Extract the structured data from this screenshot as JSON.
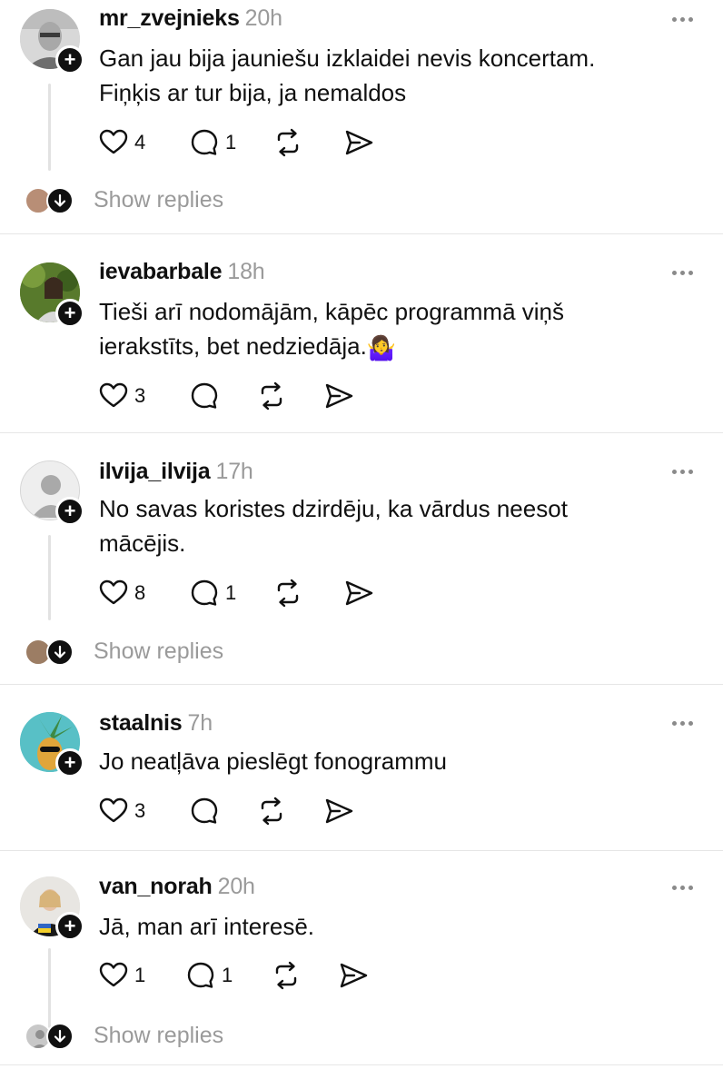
{
  "actions_labels": {
    "like": "like",
    "reply": "reply",
    "repost": "repost",
    "share": "share"
  },
  "posts": [
    {
      "username": "mr_zvejnieks",
      "time": "20h",
      "lines": [
        "Gan jau bija jauniešu izklaidei nevis koncertam.",
        "Fiņķis ar tur bija, ja nemaldos"
      ],
      "likes": "4",
      "replies": "1",
      "show_replies": "Show replies"
    },
    {
      "username": "ievabarbale",
      "time": "18h",
      "lines": [
        "Tieši arī nodomājām, kāpēc programmā viņš",
        "ierakstīts, bet nedziedāja."
      ],
      "emoji": "🤷‍♀️",
      "likes": "3",
      "replies": ""
    },
    {
      "username": "ilvija_ilvija",
      "time": "17h",
      "lines": [
        "No savas koristes dzirdēju, ka vārdus neesot",
        "mācējis."
      ],
      "likes": "8",
      "replies": "1",
      "show_replies": "Show replies"
    },
    {
      "username": "staalnis",
      "time": "7h",
      "lines": [
        "Jo neatļāva pieslēgt fonogrammu"
      ],
      "likes": "3",
      "replies": ""
    },
    {
      "username": "van_norah",
      "time": "20h",
      "lines": [
        "Jā, man arī interesē."
      ],
      "likes": "1",
      "replies": "1",
      "show_replies": "Show replies"
    }
  ],
  "colors": {
    "text": "#101010",
    "muted": "#9a9a9a",
    "divider": "#e6e6e6"
  }
}
